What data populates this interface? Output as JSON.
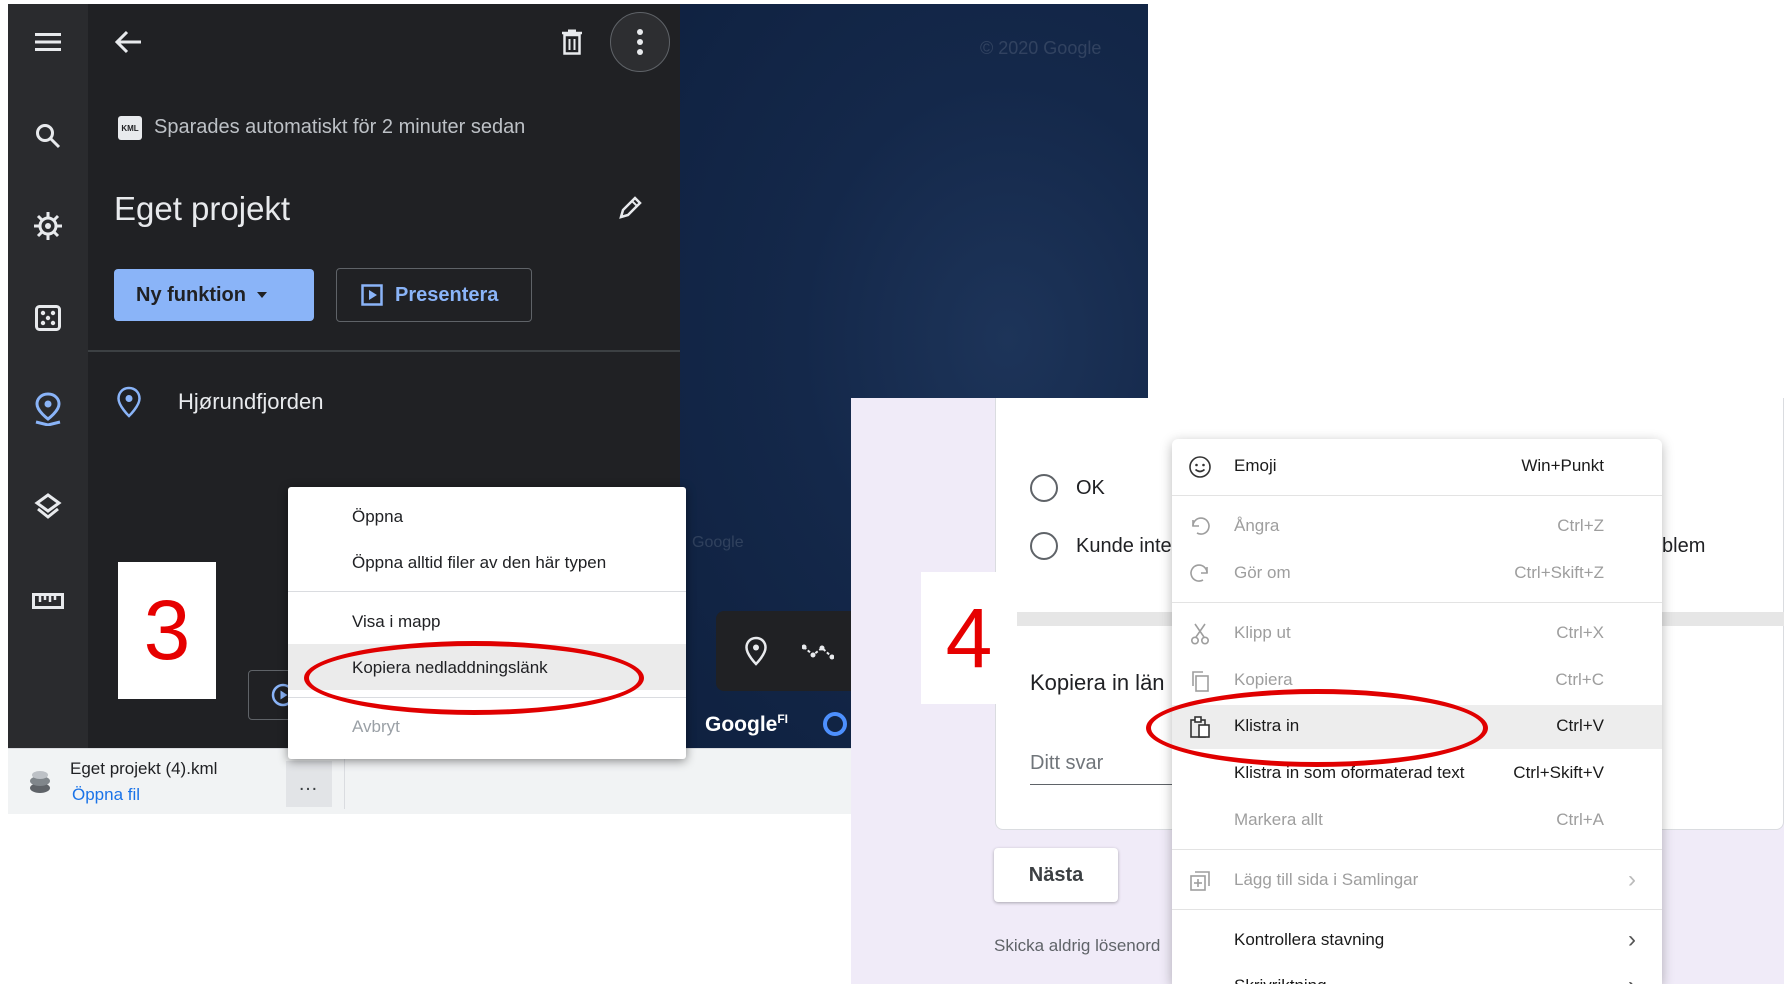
{
  "step3": {
    "badge": "3",
    "earth": {
      "saved_badge": "KML",
      "saved_text": "Sparades automatiskt för 2 minuter sedan",
      "project_title": "Eget projekt",
      "new_feature_label": "Ny funktion",
      "present_label": "Presentera",
      "feature_name": "Hjørundfjorden",
      "map_copyright": "© 2020 Google",
      "map_watermark": "Google",
      "google_logo": "Google",
      "google_logo_suffix": "FI"
    },
    "context_menu": {
      "items": [
        "Öppna",
        "Öppna alltid filer av den här typen",
        "Visa i mapp",
        "Kopiera nedladdningslänk",
        "Avbryt"
      ]
    },
    "download_bar": {
      "file_name": "Eget projekt (4).kml",
      "open_label": "Öppna fil",
      "more_label": "…"
    }
  },
  "step4": {
    "badge": "4",
    "form": {
      "options": [
        "OK",
        "Kunde inte"
      ],
      "option_tail": "blem",
      "question": "Kopiera in län",
      "answer_placeholder": "Ditt svar",
      "next_button": "Nästa",
      "footer_text": "Skicka aldrig lösenord"
    },
    "context_menu": {
      "items": [
        {
          "icon": "emoji-icon",
          "label": "Emoji",
          "shortcut": "Win+Punkt",
          "disabled": false
        },
        {
          "icon": "undo-icon",
          "label": "Ångra",
          "shortcut": "Ctrl+Z",
          "disabled": true
        },
        {
          "icon": "redo-icon",
          "label": "Gör om",
          "shortcut": "Ctrl+Skift+Z",
          "disabled": true
        },
        {
          "icon": "cut-icon",
          "label": "Klipp ut",
          "shortcut": "Ctrl+X",
          "disabled": true
        },
        {
          "icon": "copy-icon",
          "label": "Kopiera",
          "shortcut": "Ctrl+C",
          "disabled": true
        },
        {
          "icon": "paste-icon",
          "label": "Klistra in",
          "shortcut": "Ctrl+V",
          "disabled": false
        },
        {
          "icon": "",
          "label": "Klistra in som oformaterad text",
          "shortcut": "Ctrl+Skift+V",
          "disabled": false
        },
        {
          "icon": "",
          "label": "Markera allt",
          "shortcut": "Ctrl+A",
          "disabled": true
        },
        {
          "icon": "collections-icon",
          "label": "Lägg till sida i Samlingar",
          "shortcut": "",
          "disabled": true
        },
        {
          "icon": "",
          "label": "Kontrollera stavning",
          "shortcut": "",
          "disabled": false
        },
        {
          "icon": "",
          "label": "Skrivriktning",
          "shortcut": "",
          "disabled": false
        }
      ]
    }
  },
  "colors": {
    "highlight_oval": "#e00000",
    "accent_blue": "#8ab4f8",
    "earth_panel": "#202124",
    "forms_background": "#f0ebf8"
  }
}
